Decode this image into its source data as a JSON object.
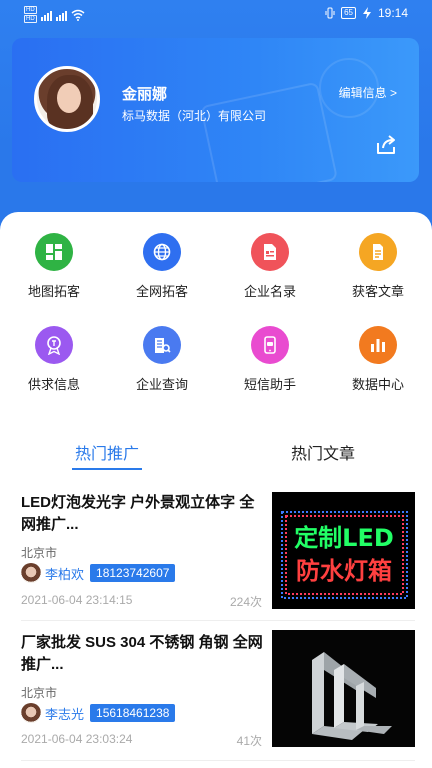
{
  "status_bar": {
    "sim1": "HD",
    "sim2": "HD",
    "battery": "65",
    "time": "19:14"
  },
  "profile": {
    "name": "金丽娜",
    "company": "标马数据（河北）有限公司",
    "edit_label": "编辑信息 >"
  },
  "grid": [
    {
      "label": "地图拓客",
      "icon": "map-icon",
      "color": "#2fb344"
    },
    {
      "label": "全网拓客",
      "icon": "globe-icon",
      "color": "#2f6ff0"
    },
    {
      "label": "企业名录",
      "icon": "directory-icon",
      "color": "#f0535a"
    },
    {
      "label": "获客文章",
      "icon": "article-icon",
      "color": "#f5a623"
    },
    {
      "label": "供求信息",
      "icon": "supply-icon",
      "color": "#9b59f0"
    },
    {
      "label": "企业查询",
      "icon": "company-search-icon",
      "color": "#4a7af0"
    },
    {
      "label": "短信助手",
      "icon": "sms-icon",
      "color": "#e94bd0"
    },
    {
      "label": "数据中心",
      "icon": "data-chart-icon",
      "color": "#f27a1f"
    }
  ],
  "tabs": {
    "active": "热门推广",
    "inactive": "热门文章"
  },
  "articles": [
    {
      "title": "LED灯泡发光字 户外景观立体字 全网推广...",
      "city": "北京市",
      "author": "李柏欢",
      "phone": "18123742607",
      "time": "2021-06-04 23:14:15",
      "views": "224次",
      "image_text_top": "定制LED",
      "image_text_bottom": "防水灯箱"
    },
    {
      "title": "厂家批发 SUS 304 不锈钢 角钢 全网推广...",
      "city": "北京市",
      "author": "李志光",
      "phone": "15618461238",
      "time": "2021-06-04 23:03:24",
      "views": "41次"
    }
  ]
}
